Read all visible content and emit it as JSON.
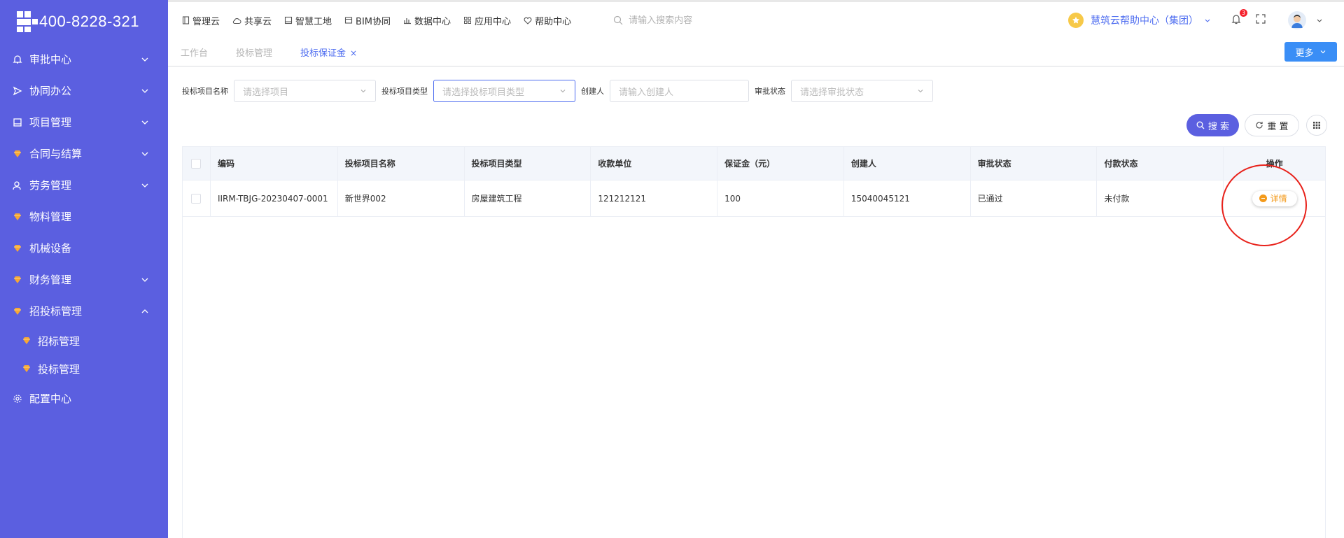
{
  "brand": {
    "phone": "400-8228-321"
  },
  "sidebar": {
    "items": [
      {
        "label": "审批中心",
        "icon": "bell-icon",
        "expanded": false,
        "has_children": true
      },
      {
        "label": "协同办公",
        "icon": "send-icon",
        "expanded": false,
        "has_children": true
      },
      {
        "label": "项目管理",
        "icon": "book-icon",
        "expanded": false,
        "has_children": true
      },
      {
        "label": "合同与结算",
        "icon": "gem-icon",
        "expanded": false,
        "has_children": true
      },
      {
        "label": "劳务管理",
        "icon": "user-icon",
        "expanded": false,
        "has_children": true
      },
      {
        "label": "物料管理",
        "icon": "gem-icon",
        "has_children": false
      },
      {
        "label": "机械设备",
        "icon": "gem-icon",
        "has_children": false
      },
      {
        "label": "财务管理",
        "icon": "gem-icon",
        "expanded": false,
        "has_children": true
      },
      {
        "label": "招投标管理",
        "icon": "gem-icon",
        "expanded": true,
        "has_children": true
      },
      {
        "label": "配置中心",
        "icon": "gear-icon",
        "has_children": false
      }
    ],
    "subitems": [
      {
        "label": "招标管理",
        "icon": "gem-icon"
      },
      {
        "label": "投标管理",
        "icon": "gem-icon"
      }
    ]
  },
  "topnav": {
    "items": [
      {
        "label": "管理云",
        "icon": "file-icon"
      },
      {
        "label": "共享云",
        "icon": "cloud-icon"
      },
      {
        "label": "智慧工地",
        "icon": "book-icon"
      },
      {
        "label": "BIM协同",
        "icon": "window-icon"
      },
      {
        "label": "数据中心",
        "icon": "chart-icon"
      },
      {
        "label": "应用中心",
        "icon": "grid-icon"
      },
      {
        "label": "帮助中心",
        "icon": "heart-icon"
      }
    ],
    "search_placeholder": "请输入搜索内容",
    "org": "慧筑云帮助中心（集团）",
    "notification_count": "3"
  },
  "tabs": [
    {
      "label": "工作台",
      "active": false
    },
    {
      "label": "投标管理",
      "active": false
    },
    {
      "label": "投标保证金",
      "active": true,
      "closable": true
    }
  ],
  "more_button": "更多",
  "filters": [
    {
      "label": "投标项目名称",
      "placeholder": "请选择项目",
      "type": "select"
    },
    {
      "label": "投标项目类型",
      "placeholder": "请选择投标项目类型",
      "type": "select"
    },
    {
      "label": "创建人",
      "placeholder": "请输入创建人",
      "type": "input"
    },
    {
      "label": "审批状态",
      "placeholder": "请选择审批状态",
      "type": "select"
    }
  ],
  "buttons": {
    "search": "搜 索",
    "reset": "重 置"
  },
  "table": {
    "headers": [
      "编码",
      "投标项目名称",
      "投标项目类型",
      "收款单位",
      "保证金（元）",
      "创建人",
      "审批状态",
      "付款状态",
      "操作"
    ],
    "rows": [
      {
        "cells": [
          "IIRM-TBJG-20230407-0001",
          "新世界002",
          "房屋建筑工程",
          "121212121",
          "100",
          "15040045121",
          "已通过",
          "未付款"
        ],
        "action": "详情"
      }
    ]
  },
  "colors": {
    "sidebar": "#5b5fe0",
    "accent": "#4d6cf0",
    "action": "#f39a1b",
    "annotation": "#e8211a"
  }
}
